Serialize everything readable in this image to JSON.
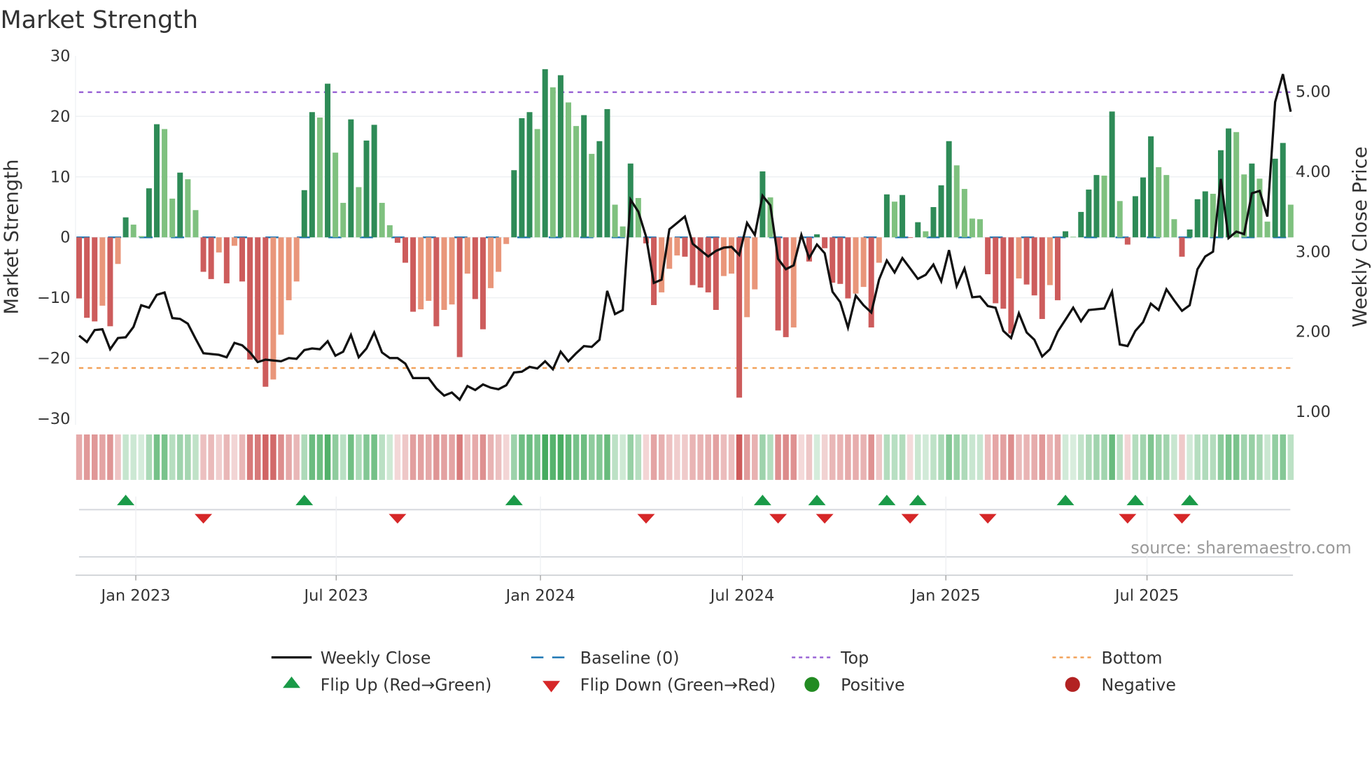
{
  "chart_data": {
    "type": "bar",
    "title": "Market Strength",
    "ylabel": "Market Strength",
    "y2label": "Weekly Close Price",
    "ylim": [
      -30,
      30
    ],
    "y2lim": [
      1.0,
      5.0
    ],
    "yticks": [
      "30",
      "20",
      "10",
      "0",
      "−10",
      "−20",
      "−30"
    ],
    "ytick_values": [
      30,
      20,
      10,
      0,
      -10,
      -20,
      -30
    ],
    "y2ticks": [
      "5.00",
      "4.00",
      "3.00",
      "2.00",
      "1.00"
    ],
    "y2tick_values": [
      5,
      4,
      3,
      2,
      1
    ],
    "top_level": 24,
    "bottom_level": -21.6,
    "baseline": 0,
    "xticks": [
      {
        "label": "Jan 2023",
        "week": 8.3
      },
      {
        "label": "Jul 2023",
        "week": 34.1
      },
      {
        "label": "Jan 2024",
        "week": 60.4
      },
      {
        "label": "Jul 2024",
        "week": 86.4
      },
      {
        "label": "Jan 2025",
        "week": 112.6
      },
      {
        "label": "Jul 2025",
        "week": 138.5
      }
    ],
    "strength": [
      -10.1,
      -13.3,
      -13.9,
      -11.3,
      -14.7,
      -4.4,
      3.3,
      2.1,
      0.2,
      8.1,
      18.7,
      17.9,
      6.4,
      10.7,
      9.6,
      4.5,
      -5.7,
      -6.9,
      -2.5,
      -7.6,
      -1.4,
      -7.3,
      -20.2,
      -20.3,
      -24.7,
      -23.5,
      -16.1,
      -10.4,
      -7.3,
      7.8,
      20.7,
      19.8,
      25.4,
      14.0,
      5.7,
      19.5,
      8.3,
      16.0,
      18.6,
      5.7,
      2.0,
      -0.9,
      -4.2,
      -12.3,
      -11.9,
      -10.5,
      -14.7,
      -12.0,
      -11.1,
      -19.8,
      -6.0,
      -10.2,
      -15.2,
      -8.4,
      -5.7,
      -1.1,
      11.1,
      19.7,
      20.7,
      17.9,
      27.8,
      24.8,
      26.8,
      22.3,
      18.4,
      20.2,
      13.8,
      15.9,
      21.2,
      5.4,
      1.8,
      12.2,
      6.5,
      -1.0,
      -11.2,
      -9.1,
      -5.2,
      -3.0,
      -3.2,
      -7.9,
      -8.3,
      -9.1,
      -12.0,
      -6.4,
      -6.0,
      -26.5,
      -13.2,
      -8.6,
      10.9,
      6.6,
      -15.4,
      -16.5,
      -14.9,
      -0.2,
      -4.0,
      0.5,
      -1.8,
      -7.5,
      -7.7,
      -10.1,
      -9.3,
      -8.2,
      -14.9,
      -4.2,
      7.1,
      5.9,
      7.0,
      -0.1,
      2.5,
      1.0,
      5.0,
      8.6,
      15.9,
      11.9,
      8.0,
      3.1,
      3.0,
      -6.1,
      -10.9,
      -11.8,
      -15.9,
      -6.8,
      -7.8,
      -9.6,
      -13.5,
      -7.9,
      -10.4,
      1.0,
      0.1,
      4.2,
      7.9,
      10.3,
      10.2,
      20.8,
      6.0,
      -1.2,
      6.8,
      9.9,
      16.7,
      11.6,
      10.3,
      3.0,
      -3.2,
      1.3,
      6.3,
      7.6,
      7.2,
      14.4,
      18.0,
      17.4,
      10.4,
      12.2,
      9.7,
      2.6,
      13.0,
      15.6,
      5.4
    ],
    "weekly_close": [
      1.94,
      1.86,
      2.01,
      2.02,
      1.77,
      1.91,
      1.92,
      2.05,
      2.32,
      2.29,
      2.45,
      2.48,
      2.16,
      2.15,
      2.09,
      1.9,
      1.72,
      1.71,
      1.7,
      1.67,
      1.85,
      1.82,
      1.73,
      1.61,
      1.64,
      1.63,
      1.62,
      1.66,
      1.65,
      1.76,
      1.78,
      1.77,
      1.87,
      1.69,
      1.74,
      1.95,
      1.67,
      1.78,
      1.98,
      1.73,
      1.66,
      1.66,
      1.59,
      1.41,
      1.41,
      1.41,
      1.28,
      1.19,
      1.23,
      1.14,
      1.31,
      1.26,
      1.33,
      1.29,
      1.27,
      1.32,
      1.48,
      1.49,
      1.55,
      1.53,
      1.62,
      1.52,
      1.74,
      1.62,
      1.72,
      1.81,
      1.8,
      1.89,
      2.5,
      2.21,
      2.26,
      3.64,
      3.49,
      3.18,
      2.6,
      2.64,
      3.27,
      3.35,
      3.43,
      3.09,
      3.01,
      2.93,
      3.0,
      3.04,
      3.05,
      2.95,
      3.35,
      3.2,
      3.69,
      3.57,
      2.9,
      2.77,
      2.82,
      3.2,
      2.91,
      3.08,
      2.97,
      2.49,
      2.36,
      2.04,
      2.44,
      2.32,
      2.23,
      2.64,
      2.88,
      2.73,
      2.91,
      2.78,
      2.65,
      2.7,
      2.83,
      2.62,
      3.01,
      2.56,
      2.78,
      2.42,
      2.43,
      2.31,
      2.29,
      2.0,
      1.91,
      2.22,
      1.98,
      1.89,
      1.68,
      1.77,
      1.99,
      2.14,
      2.29,
      2.12,
      2.26,
      2.27,
      2.28,
      2.49,
      1.83,
      1.81,
      2.0,
      2.11,
      2.34,
      2.26,
      2.52,
      2.38,
      2.25,
      2.32,
      2.77,
      2.93,
      2.99,
      3.9,
      3.16,
      3.24,
      3.21,
      3.72,
      3.75,
      3.43,
      4.86,
      5.21,
      4.74
    ],
    "legend": [
      {
        "key": "weekly-close",
        "label": "Weekly Close"
      },
      {
        "key": "baseline",
        "label": "Baseline (0)"
      },
      {
        "key": "top",
        "label": "Top"
      },
      {
        "key": "bottom",
        "label": "Bottom"
      },
      {
        "key": "flip-up",
        "label": "Flip Up (Red→Green)"
      },
      {
        "key": "flip-down",
        "label": "Flip Down (Green→Red)"
      },
      {
        "key": "positive",
        "label": "Positive"
      },
      {
        "key": "negative",
        "label": "Negative"
      }
    ],
    "legend_position": "bottom",
    "source": "source: sharemaestro.com",
    "colors": {
      "pos_strong": "#2e8b57",
      "pos_weak": "#7fc17f",
      "neg_strong": "#cd5c5c",
      "neg_weak": "#e9967a",
      "line": "#111111",
      "baseline": "#1f77b4",
      "top": "#9b66d6",
      "bottom": "#f2a25a",
      "flip_up": "#1a9a48",
      "flip_down": "#d62728",
      "positive": "#228b22",
      "negative": "#b22222"
    }
  }
}
